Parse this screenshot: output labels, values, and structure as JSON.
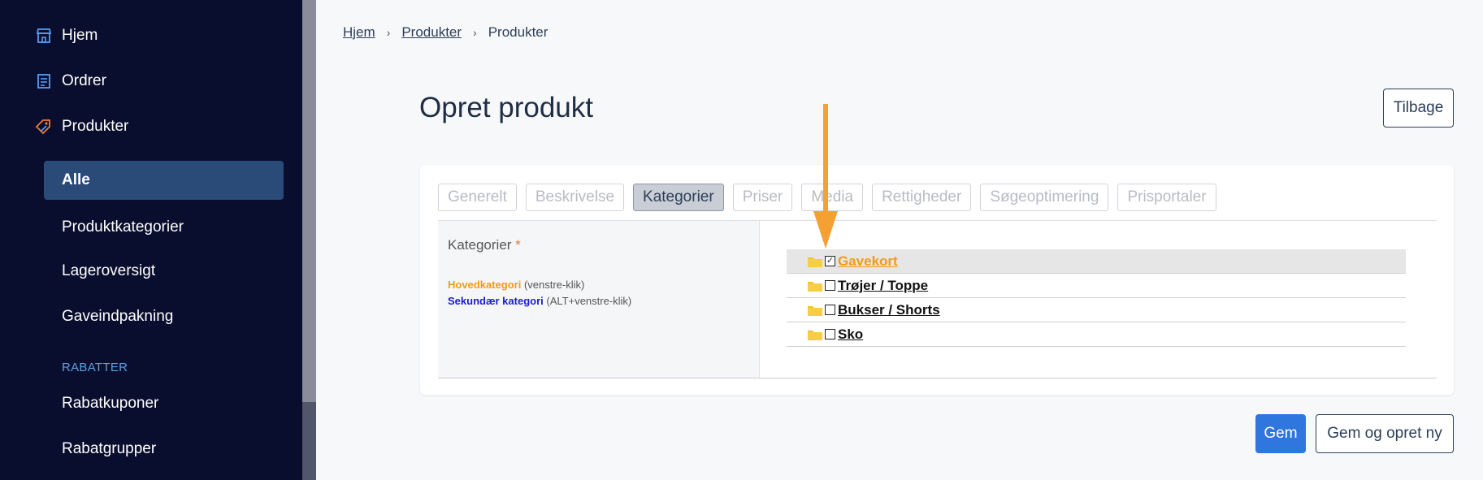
{
  "sidebar": {
    "main_items": [
      {
        "label": "Hjem",
        "icon": "store-icon"
      },
      {
        "label": "Ordrer",
        "icon": "list-icon"
      },
      {
        "label": "Produkter",
        "icon": "tag-icon"
      }
    ],
    "sub_items": [
      {
        "label": "Alle",
        "active": true
      },
      {
        "label": "Produktkategorier"
      },
      {
        "label": "Lageroversigt"
      },
      {
        "label": "Gaveindpakning"
      }
    ],
    "section_label": "RABATTER",
    "section_items": [
      {
        "label": "Rabatkuponer"
      },
      {
        "label": "Rabatgrupper"
      }
    ]
  },
  "breadcrumb": [
    "Hjem",
    "Produkter",
    "Produkter"
  ],
  "page": {
    "title": "Opret produkt",
    "back_label": "Tilbage"
  },
  "tabs": [
    "Generelt",
    "Beskrivelse",
    "Kategorier",
    "Priser",
    "Media",
    "Rettigheder",
    "Søgeoptimering",
    "Prisportaler"
  ],
  "active_tab": "Kategorier",
  "categories_panel": {
    "label": "Kategorier",
    "required_mark": "*",
    "legend_main": "Hovedkategori",
    "legend_main_hint": "(venstre-klik)",
    "legend_secondary": "Sekundær kategori",
    "legend_secondary_hint": "(ALT+venstre-klik)"
  },
  "category_tree": [
    {
      "label": "Gavekort",
      "checked": true,
      "checkbox_symbol": "✓"
    },
    {
      "label": "Trøjer / Toppe",
      "checked": false,
      "checkbox_symbol": ""
    },
    {
      "label": "Bukser / Shorts",
      "checked": false,
      "checkbox_symbol": ""
    },
    {
      "label": "Sko",
      "checked": false,
      "checkbox_symbol": ""
    }
  ],
  "footer": {
    "save_label": "Gem",
    "save_new_label": "Gem og opret ny"
  },
  "colors": {
    "sidebar_bg": "#0a0e2e",
    "active_nav": "#2a4a78",
    "primary_button": "#2f76de",
    "main_category": "#f39c12",
    "secondary_category": "#1a1adb",
    "arrow": "#f5a033"
  }
}
